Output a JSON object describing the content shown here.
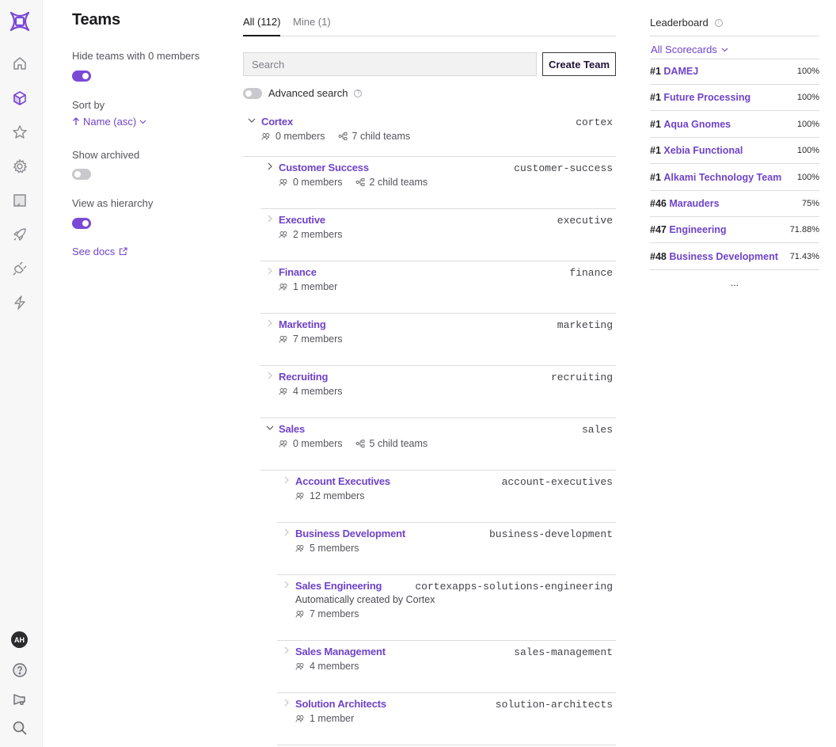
{
  "nav": {
    "logo": "cortex-logo-icon",
    "items": [
      {
        "icon": "home-icon",
        "active": false
      },
      {
        "icon": "catalog-cube-icon",
        "active": true
      },
      {
        "icon": "star-icon",
        "active": false
      },
      {
        "icon": "gear-icon",
        "active": false
      },
      {
        "icon": "scorecard-icon",
        "active": false
      },
      {
        "icon": "rocket-icon",
        "active": false
      },
      {
        "icon": "plug-icon",
        "active": false
      },
      {
        "icon": "lightning-icon",
        "active": false
      }
    ],
    "bottom": {
      "avatar_initials": "AH",
      "help_icon": "help-circle-icon",
      "announce_icon": "megaphone-icon",
      "search_icon": "search-icon"
    }
  },
  "filters": {
    "title": "Teams",
    "hide_empty": {
      "label": "Hide teams with 0 members",
      "on": true
    },
    "sort": {
      "label": "Sort by",
      "value": "Name (asc)"
    },
    "show_archived": {
      "label": "Show archived",
      "on": false
    },
    "hierarchy": {
      "label": "View as hierarchy",
      "on": true
    },
    "docs_link": "See docs"
  },
  "main": {
    "tabs": [
      {
        "label": "All (112)",
        "active": true
      },
      {
        "label": "Mine (1)",
        "active": false
      }
    ],
    "search": {
      "placeholder": "Search",
      "value": ""
    },
    "create_button": "Create Team",
    "advanced_search": {
      "label": "Advanced search",
      "on": false
    },
    "teams": [
      {
        "name": "Cortex",
        "slug": "cortex",
        "members": "0 members",
        "children": "7 child teams",
        "expanded": true,
        "level": 0
      },
      {
        "name": "Customer Success",
        "slug": "customer-success",
        "members": "0 members",
        "children": "2 child teams",
        "expanded": false,
        "level": 1
      },
      {
        "name": "Executive",
        "slug": "executive",
        "members": "2 members",
        "level": 1
      },
      {
        "name": "Finance",
        "slug": "finance",
        "members": "1 member",
        "level": 1
      },
      {
        "name": "Marketing",
        "slug": "marketing",
        "members": "7 members",
        "level": 1
      },
      {
        "name": "Recruiting",
        "slug": "recruiting",
        "members": "4 members",
        "level": 1
      },
      {
        "name": "Sales",
        "slug": "sales",
        "members": "0 members",
        "children": "5 child teams",
        "expanded": true,
        "level": 1
      },
      {
        "name": "Account Executives",
        "slug": "account-executives",
        "members": "12 members",
        "level": 2
      },
      {
        "name": "Business Development",
        "slug": "business-development",
        "members": "5 members",
        "level": 2
      },
      {
        "name": "Sales Engineering",
        "slug": "cortexapps-solutions-engineering",
        "description": "Automatically created by Cortex",
        "members": "7 members",
        "level": 2
      },
      {
        "name": "Sales Management",
        "slug": "sales-management",
        "members": "4 members",
        "level": 2
      },
      {
        "name": "Solution Architects",
        "slug": "solution-architects",
        "members": "1 member",
        "level": 2
      }
    ]
  },
  "leaderboard": {
    "title": "Leaderboard",
    "filter": "All Scorecards",
    "rows": [
      {
        "rank": "#1",
        "name": "DAMEJ",
        "score": "100%"
      },
      {
        "rank": "#1",
        "name": "Future Processing",
        "score": "100%"
      },
      {
        "rank": "#1",
        "name": "Aqua Gnomes",
        "score": "100%"
      },
      {
        "rank": "#1",
        "name": "Xebia Functional",
        "score": "100%"
      },
      {
        "rank": "#1",
        "name": "Alkami Technology Team",
        "score": "100%"
      },
      {
        "rank": "#46",
        "name": "Marauders",
        "score": "75%"
      },
      {
        "rank": "#47",
        "name": "Engineering",
        "score": "71.88%"
      },
      {
        "rank": "#48",
        "name": "Business Development",
        "score": "71.43%"
      }
    ],
    "more": "..."
  },
  "colors": {
    "accent": "#6f43c9",
    "toggle_on": "#7a49d6",
    "toggle_off": "#c9c9cd",
    "rail_bg": "#f7f7f8"
  }
}
